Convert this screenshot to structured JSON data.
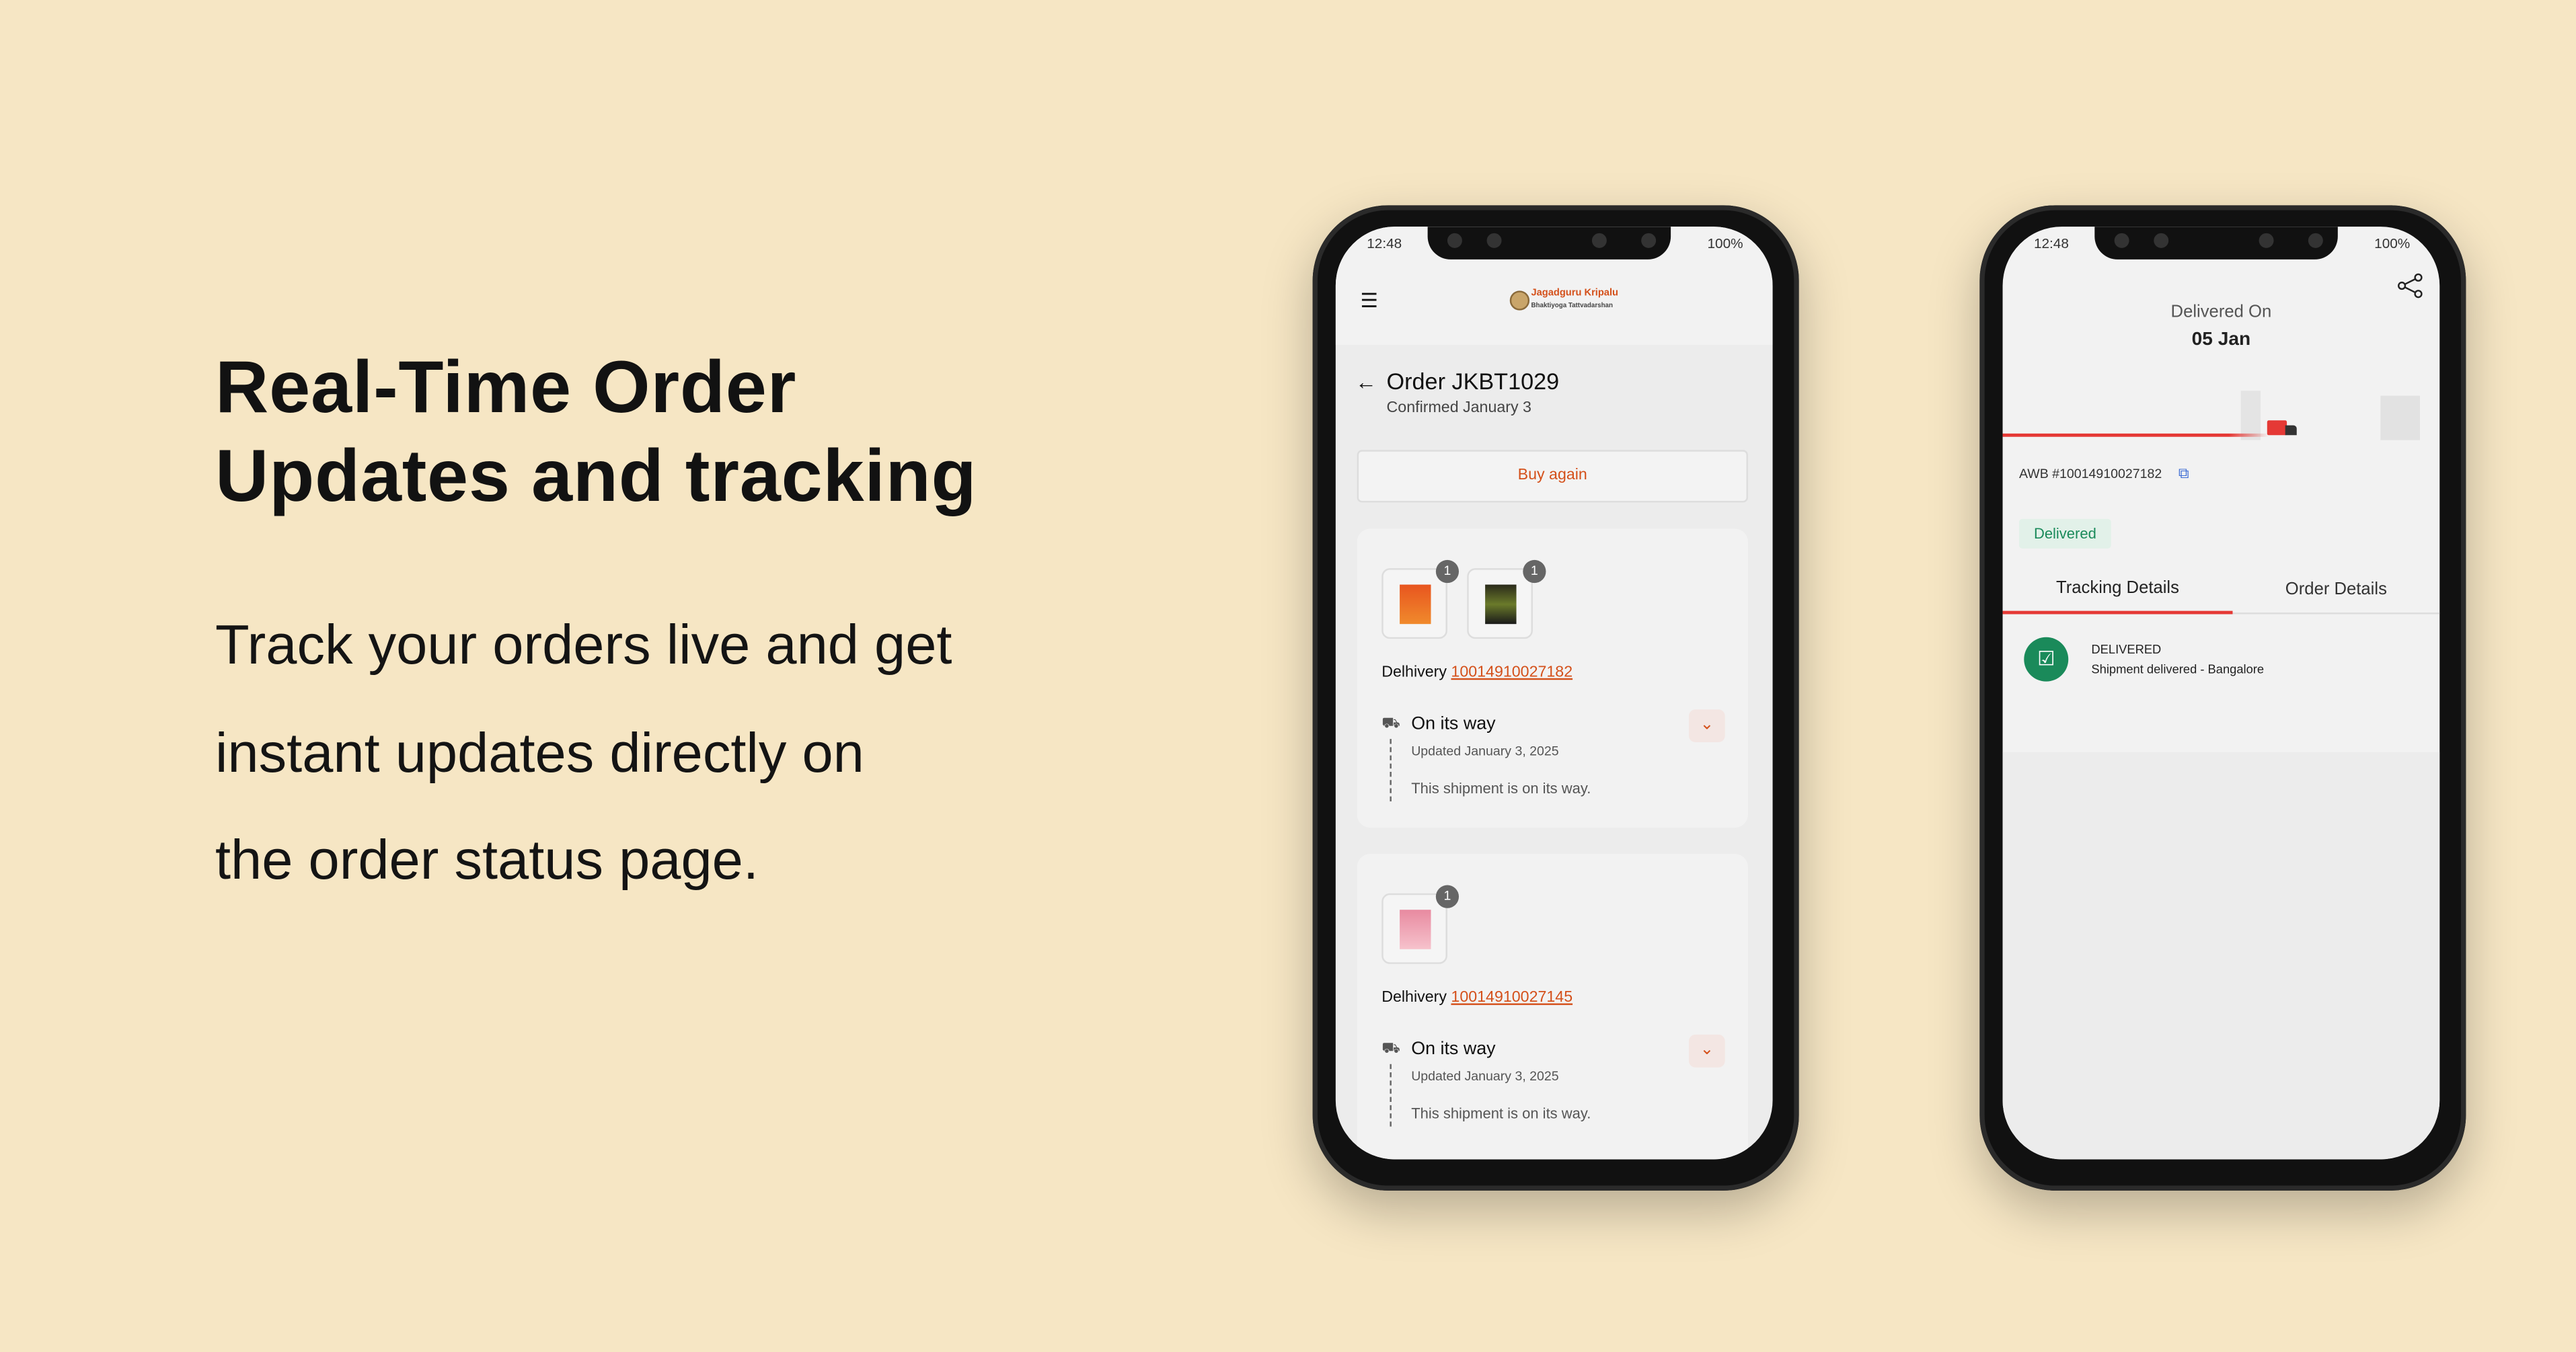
{
  "headline": {
    "line1": "Real-Time Order",
    "line2": "Updates and tracking"
  },
  "description": {
    "line1": "Track your orders live and get",
    "line2": "instant updates directly on",
    "line3": "the order status page."
  },
  "status_bar": {
    "time": "12:48",
    "battery": "100%"
  },
  "order_screen": {
    "brand": {
      "name": "Jagadguru Kripalu",
      "tagline": "Bhaktiyoga Tattvadarshan"
    },
    "title": "Order JKBT1029",
    "subtitle": "Confirmed January 3",
    "buy_again": "Buy again",
    "shipments": [
      {
        "carrier": "Delhivery",
        "tracking": "10014910027182",
        "item_counts": [
          "1",
          "1"
        ],
        "status": "On its way",
        "updated": "Updated January 3, 2025",
        "message": "This shipment is on its way."
      },
      {
        "carrier": "Delhivery",
        "tracking": "10014910027145",
        "item_counts": [
          "1"
        ],
        "status": "On its way",
        "updated": "Updated January 3, 2025",
        "message": "This shipment is on its way."
      }
    ]
  },
  "tracking_screen": {
    "delivered_on_label": "Delivered On",
    "delivered_date": "05 Jan",
    "awb": "AWB #10014910027182",
    "status_badge": "Delivered",
    "tabs": [
      "Tracking Details",
      "Order Details"
    ],
    "active_tab": "Tracking Details",
    "events": [
      {
        "title": "DELIVERED",
        "detail": "Shipment delivered - Bangalore"
      }
    ]
  },
  "colors": {
    "background": "#f6e6c4",
    "accent": "#d4501a",
    "success": "#1a8a5a",
    "tab_underline": "#e53935"
  }
}
